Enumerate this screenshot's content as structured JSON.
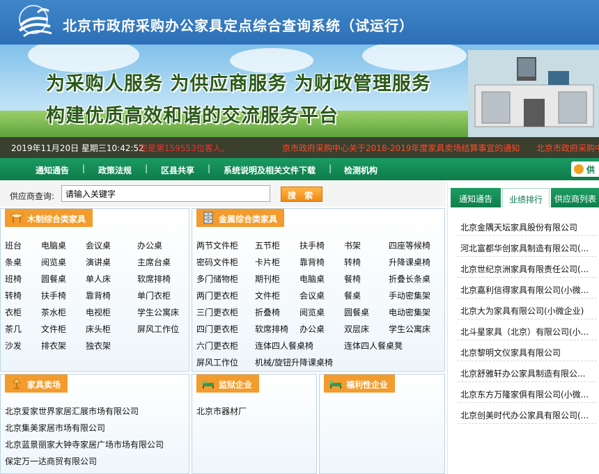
{
  "header": {
    "title": "北京市政府采购办公家具定点综合查询系统（试运行）"
  },
  "banner": {
    "slogan1": "为采购人服务  为供应商服务  为财政管理服务",
    "slogan2": "构建优质高效和谐的交流服务平台"
  },
  "status": {
    "datetime": "2019年11月20日 星期三10:42:52",
    "visitor": "您是第159553位客人。",
    "news1": "京市政府采购中心关于2018-2019年度家具卖场结算事宜的通知",
    "news2": "北京市政府采购中"
  },
  "nav": {
    "items": [
      "通知通告",
      "政策法规",
      "区县共享",
      "系统说明及相关文件下载",
      "检测机构"
    ],
    "separator": "|",
    "supply_label": "供"
  },
  "search": {
    "label": "供应商查询:",
    "value": "请输入关键字",
    "button": "搜 索"
  },
  "wood": {
    "title": "木制综合类家具",
    "rows": [
      [
        "班台",
        "电脑桌",
        "会议桌",
        "办公桌"
      ],
      [
        "条桌",
        "阅览桌",
        "演讲桌",
        "主席台桌"
      ],
      [
        "班椅",
        "圆餐桌",
        "单人床",
        "软席排椅"
      ],
      [
        "转椅",
        "扶手椅",
        "靠背椅",
        "单门衣柜"
      ],
      [
        "衣柜",
        "茶水柜",
        "电视柜",
        "学生公寓床"
      ],
      [
        "茶几",
        "文件柜",
        "床头柜",
        "屏风工作位"
      ],
      [
        "沙发",
        "排衣架",
        "独衣架",
        ""
      ]
    ]
  },
  "metal": {
    "title": "金属综合类家具",
    "rows": [
      [
        "两节文件柜",
        "五节柜",
        "扶手椅",
        "书架",
        "四座等候椅"
      ],
      [
        "密码文件柜",
        "卡片柜",
        "靠背椅",
        "转椅",
        "升降课桌椅"
      ],
      [
        "多门储物柜",
        "期刊柜",
        "电脑桌",
        "餐椅",
        "折叠长条桌"
      ],
      [
        "两门更衣柜",
        "文件柜",
        "会议桌",
        "餐桌",
        "手动密集架"
      ],
      [
        "三门更衣柜",
        "折叠椅",
        "阅览桌",
        "圆餐桌",
        "电动密集架"
      ],
      [
        "四门更衣柜",
        "软席排椅",
        "办公桌",
        "双层床",
        "学生公寓床"
      ],
      [
        "六门更衣柜",
        "连体四人餐桌椅",
        "",
        "连体四人餐桌凳",
        ""
      ],
      [
        "屏风工作位",
        "机械/旋钮升降课桌椅",
        "",
        "",
        ""
      ]
    ]
  },
  "market": {
    "title": "家具卖场",
    "items": [
      "北京爱家世界家居汇展市场有限公司",
      "北京集美家居市场有限公司",
      "北京蓝景丽家大钟寺家居广场市场有限公司",
      "保定万一达商贸有限公司"
    ]
  },
  "prison": {
    "title": "监狱企业",
    "items": [
      "北京市器材厂"
    ]
  },
  "welfare": {
    "title": "福利性企业",
    "items": []
  },
  "right": {
    "tabs": [
      "通知通告",
      "业绩排行",
      "供应商列表"
    ],
    "items": [
      "北京金隅天坛家具股份有限公司",
      "河北富都华创家具制造有限公司(...",
      "北京世纪京洲家具有限责任公司(...",
      "北京嘉利信得家具有限公司(小微...",
      "北京大为家具有限公司(小微企业)",
      "北斗星家具（北京）有限公司(小...",
      "北京黎明文仪家具有限公司",
      "北京舒雅轩办公家具制造有限公...",
      "北京东方万隆家俱有限公司(小微...",
      "北京创美时代办公家具有限公司(..."
    ]
  },
  "colors": {
    "header_blue": "#2d6fb6",
    "nav_green": "#0e7c4a",
    "orange": "#f39b2c",
    "alert_red": "#ff2a2a"
  }
}
